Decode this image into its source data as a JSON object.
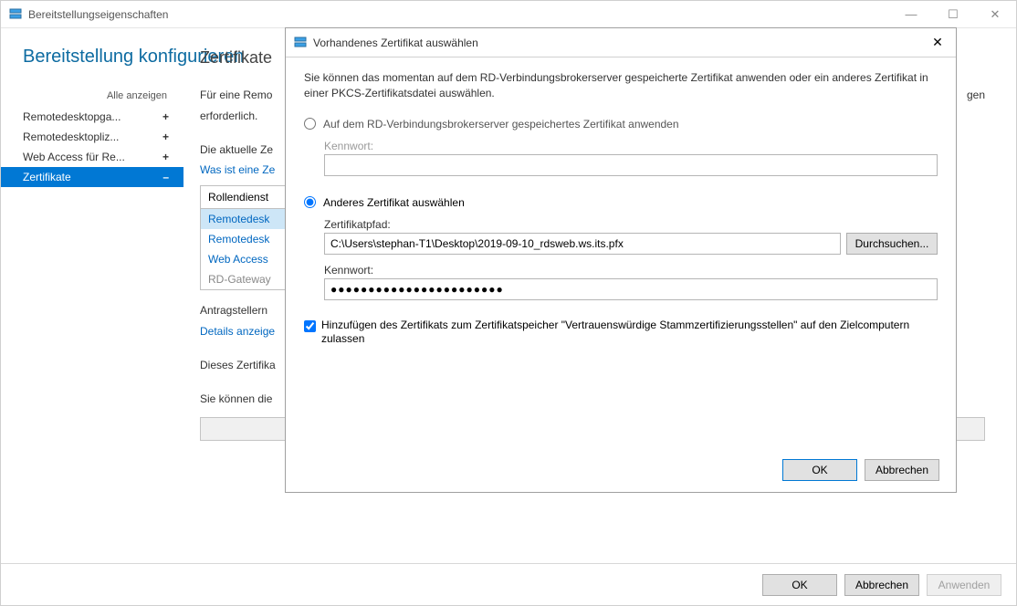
{
  "parent": {
    "title": "Bereitstellungseigenschaften",
    "heading": "Bereitstellung konfigurieren",
    "showAll": "Alle anzeigen",
    "nav": [
      {
        "label": "Remotedesktopga...",
        "indicator": "+"
      },
      {
        "label": "Remotedesktopliz...",
        "indicator": "+"
      },
      {
        "label": "Web Access für Re...",
        "indicator": "+"
      },
      {
        "label": "Zertifikate",
        "indicator": "–"
      }
    ],
    "sectionTitle": "Zertifikate",
    "line1": "Für eine Remo",
    "line2": "erforderlich.",
    "line3": "Die aktuelle Ze",
    "link1": "Was ist eine Ze",
    "tableHeader": "Rollendienst",
    "tableRows": [
      {
        "label": "Remotedesk",
        "selected": true
      },
      {
        "label": "Remotedesk",
        "selected": false
      },
      {
        "label": "Web Access",
        "selected": false
      },
      {
        "label": "RD-Gateway",
        "selected": false,
        "muted": true
      }
    ],
    "line4": "Antragstellern",
    "link2": "Details anzeige",
    "line5": "Dieses Zertifika",
    "line6": "Sie können die",
    "trailingText": "gen",
    "footer": {
      "ok": "OK",
      "cancel": "Abbrechen",
      "apply": "Anwenden"
    }
  },
  "dialog": {
    "title": "Vorhandenes Zertifikat auswählen",
    "intro": "Sie können das momentan auf dem RD-Verbindungsbrokerserver gespeicherte Zertifikat anwenden oder ein anderes Zertifikat in einer PKCS-Zertifikatsdatei auswählen.",
    "radio1": "Auf dem RD-Verbindungsbrokerserver gespeichertes Zertifikat anwenden",
    "pwLabel1": "Kennwort:",
    "radio2": "Anderes Zertifikat auswählen",
    "pathLabel": "Zertifikatpfad:",
    "pathValue": "C:\\Users\\stephan-T1\\Desktop\\2019-09-10_rdsweb.ws.its.pfx",
    "browse": "Durchsuchen...",
    "pwLabel2": "Kennwort:",
    "pwValue": "●●●●●●●●●●●●●●●●●●●●●●●",
    "checkLabel": "Hinzufügen des Zertifikats zum Zertifikatspeicher \"Vertrauenswürdige Stammzertifizierungsstellen\" auf den Zielcomputern zulassen",
    "ok": "OK",
    "cancel": "Abbrechen"
  }
}
